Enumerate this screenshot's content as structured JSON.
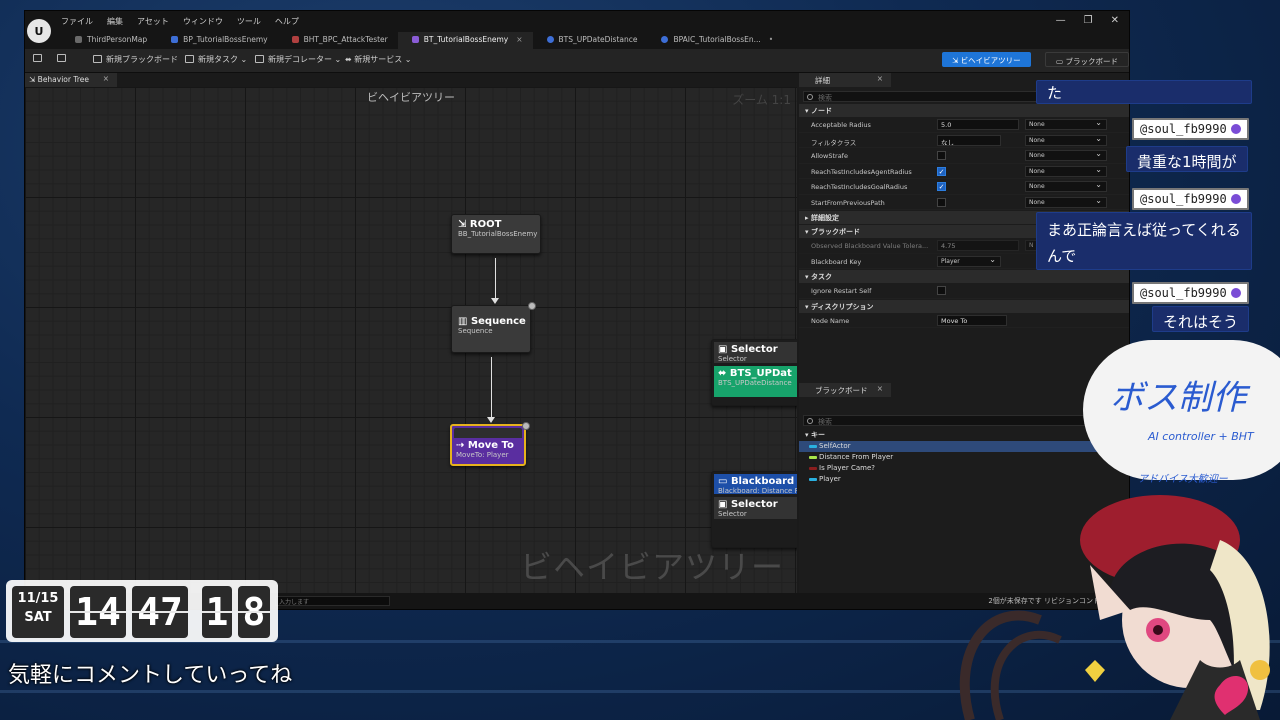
{
  "editor": {
    "menu": [
      "ファイル",
      "編集",
      "アセット",
      "ウィンドウ",
      "ツール",
      "ヘルプ"
    ],
    "tabs": [
      {
        "label": "ThirdPersonMap",
        "color": "#6a6a6a",
        "active": false
      },
      {
        "label": "BP_TutorialBossEnemy",
        "color": "#3d6ed6",
        "active": false
      },
      {
        "label": "BHT_BPC_AttackTester",
        "color": "#b04040",
        "active": false
      },
      {
        "label": "BT_TutorialBossEnemy",
        "color": "#8a5cd6",
        "active": true
      },
      {
        "label": "BTS_UPDateDistance",
        "color": "#3d6ed6",
        "active": false
      },
      {
        "label": "BPAIC_TutorialBossEn...",
        "color": "#3d6ed6",
        "active": false
      }
    ],
    "toolbar": {
      "new_blackboard": "新規ブラックボード",
      "new_task": "新規タスク",
      "new_decorator": "新規デコレーター",
      "new_service": "新規サービス",
      "mode_behavior_tree": "ビヘイビアツリー",
      "mode_blackboard": "ブラックボード"
    },
    "graph": {
      "tab_label": "Behavior Tree",
      "header": "ビヘイビアツリー",
      "zoom": "ズーム 1:1",
      "watermark": "ビヘイビアツリー",
      "nodes": {
        "root_title": "ROOT",
        "root_sub": "BB_TutorialBossEnemy",
        "seq_title": "Sequence",
        "seq_sub": "Sequence",
        "move_title": "Move To",
        "move_sub": "MoveTo: Player",
        "sel1_title": "Selector",
        "sel1_sub": "Selector",
        "bts_title": "BTS_UPDat",
        "bts_sub": "BTS_UPDateDistance",
        "bb_title": "Blackboard B",
        "bb_sub": "Blackboard: Distance Fr",
        "sel2_title": "Selector",
        "sel2_sub": "Selector"
      }
    },
    "details": {
      "tab_label": "詳細",
      "search_placeholder": "検索",
      "sections": {
        "node": "ノード",
        "advanced": "詳細設定",
        "blackboard": "ブラックボード",
        "task": "タスク",
        "description": "ディスクリプション"
      },
      "rows": {
        "acceptable_radius": {
          "label": "Acceptable Radius",
          "value": "5.0",
          "dd": "None"
        },
        "filter_class": {
          "label": "フィルタクラス",
          "value": "なし",
          "dd": "None"
        },
        "allow_strafe": {
          "label": "AllowStrafe",
          "dd": "None"
        },
        "reach_agent": {
          "label": "ReachTestIncludesAgentRadius",
          "dd": "None"
        },
        "reach_goal": {
          "label": "ReachTestIncludesGoalRadius",
          "dd": "None"
        },
        "start_prev": {
          "label": "StartFromPreviousPath",
          "dd": "None"
        },
        "observed_tol": {
          "label": "Observed Blackboard Value Tolera...",
          "value": "4.75",
          "dd": "N"
        },
        "bb_key": {
          "label": "Blackboard Key",
          "value": "Player"
        },
        "ignore_restart": {
          "label": "Ignore Restart Self"
        },
        "node_name": {
          "label": "Node Name",
          "value": "Move To"
        }
      }
    },
    "blackboard": {
      "tab_label": "ブラックボード",
      "search_placeholder": "検索",
      "key_header": "キー",
      "keys": [
        {
          "name": "SelfActor",
          "color": "#2ab0e0",
          "selected": true
        },
        {
          "name": "Distance From Player",
          "color": "#a8e64a",
          "selected": false
        },
        {
          "name": "Is Player Came?",
          "color": "#8a1e1e",
          "selected": false
        },
        {
          "name": "Player",
          "color": "#2ab0e0",
          "selected": false
        }
      ]
    },
    "status": {
      "input_placeholder": "入力します",
      "right": "2個が未保存です  リビジョンコントロール"
    }
  },
  "chat": {
    "messages": [
      {
        "text": "た"
      },
      {
        "user": "@soul_fb9990",
        "text": "貴重な1時間が"
      },
      {
        "user": "@soul_fb9990",
        "text": "まあ正論言えば従ってくれるんで"
      },
      {
        "user": "@soul_fb9990",
        "text": "それはそう"
      }
    ]
  },
  "clock": {
    "date": "11/15",
    "weekday": "SAT",
    "h1": "14",
    "m1": "47",
    "s1": "1",
    "s2": "8"
  },
  "comment_prompt": "気軽にコメントしていってね",
  "overlay_title": {
    "main": "ボス制作",
    "sub1": "AI controller + BHT",
    "sub2": "アドバイス大歓迎ー"
  }
}
